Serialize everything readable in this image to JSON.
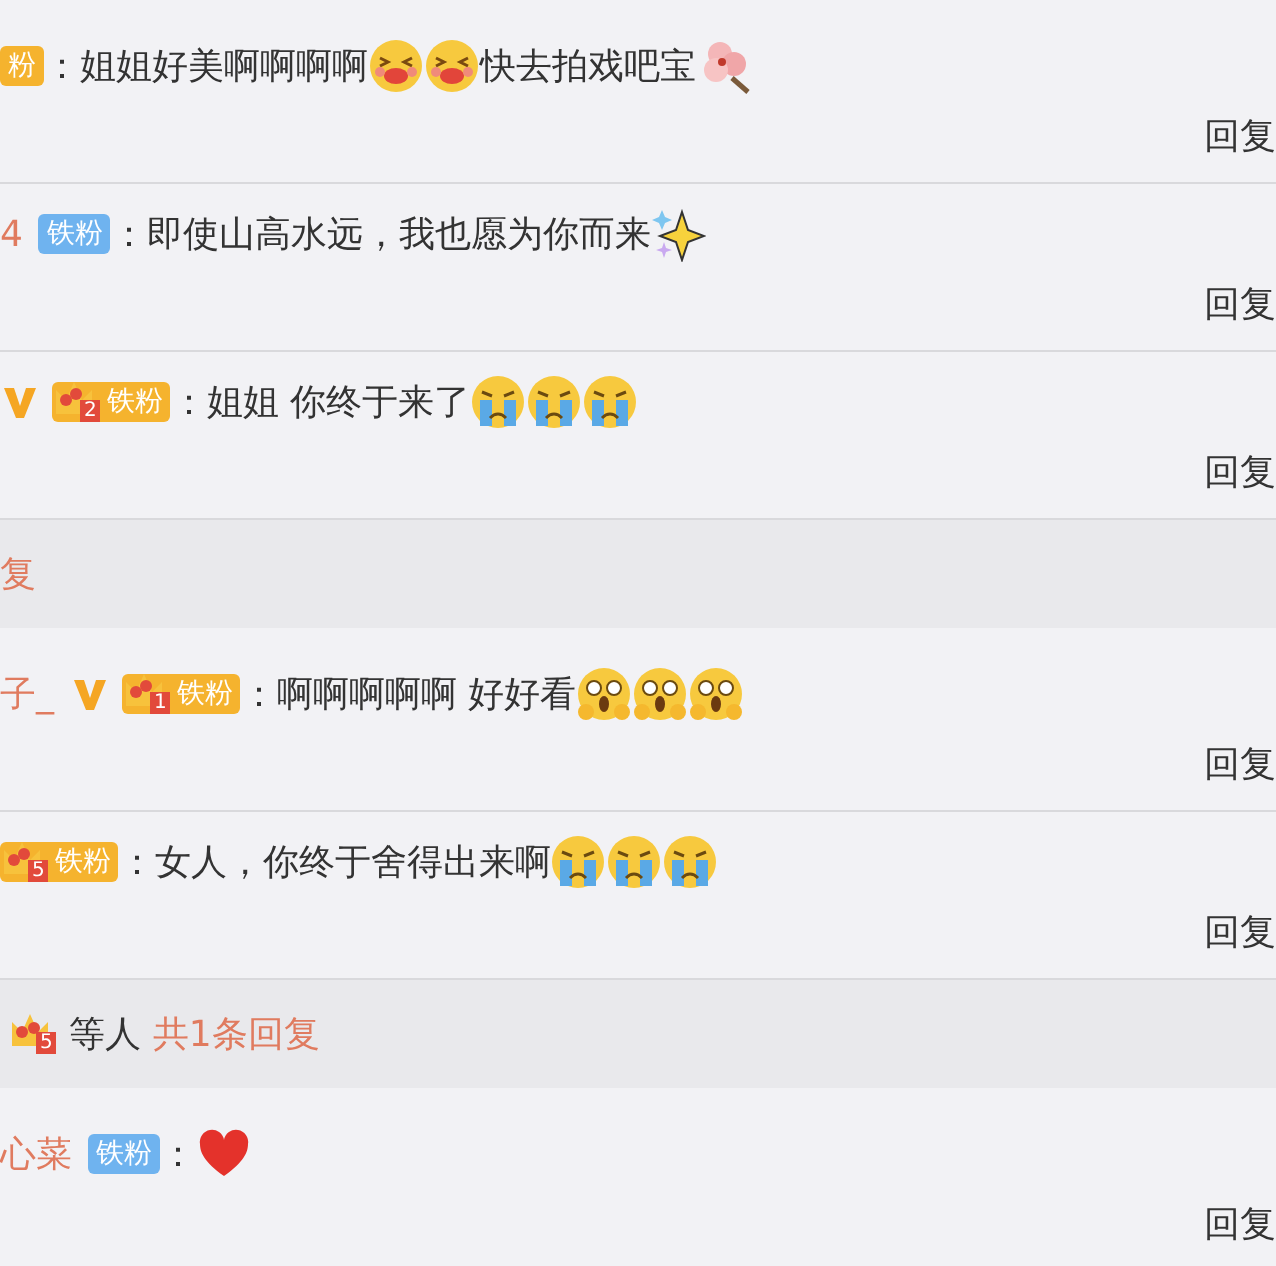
{
  "items": [
    {
      "kind": "comment",
      "vip": false,
      "badge": {
        "kind": "orange",
        "label": "粉"
      },
      "message": [
        {
          "kind": "text",
          "text": "：姐姐好美啊啊啊啊"
        },
        {
          "kind": "kiss"
        },
        {
          "kind": "kiss"
        },
        {
          "kind": "text",
          "text": "快去拍戏吧宝"
        },
        {
          "kind": "flower"
        }
      ],
      "reply": "回复"
    },
    {
      "kind": "comment",
      "user": "4",
      "vip": false,
      "badge": {
        "kind": "blue",
        "label": "铁粉"
      },
      "message": [
        {
          "kind": "text",
          "text": "：即使山高水远，我也愿为你而来"
        },
        {
          "kind": "sparkle"
        }
      ],
      "reply": "回复"
    },
    {
      "kind": "comment",
      "vip": true,
      "badge": {
        "kind": "crown",
        "rank": "2",
        "label": "铁粉"
      },
      "message": [
        {
          "kind": "text",
          "text": "：姐姐 你终于来了"
        },
        {
          "kind": "cry"
        },
        {
          "kind": "cry"
        },
        {
          "kind": "cry"
        }
      ],
      "reply": "回复"
    },
    {
      "kind": "summary",
      "count_text": "复"
    },
    {
      "kind": "comment",
      "user": "子_",
      "vip": true,
      "badge": {
        "kind": "crown",
        "rank": "1",
        "label": "铁粉"
      },
      "message": [
        {
          "kind": "text",
          "text": "：啊啊啊啊啊 好好看"
        },
        {
          "kind": "scared"
        },
        {
          "kind": "scared"
        },
        {
          "kind": "scared"
        }
      ],
      "reply": "回复"
    },
    {
      "kind": "comment",
      "vip": false,
      "badge": {
        "kind": "crown",
        "rank": "5",
        "label": "铁粉"
      },
      "message": [
        {
          "kind": "text",
          "text": "：女人，你终于舍得出来啊"
        },
        {
          "kind": "cry"
        },
        {
          "kind": "cry"
        },
        {
          "kind": "cry"
        }
      ],
      "reply": "回复"
    },
    {
      "kind": "summary",
      "crown_rank": "5",
      "names": "等人",
      "count_text": "共1条回复"
    },
    {
      "kind": "comment",
      "user": "心菜",
      "vip": false,
      "badge": {
        "kind": "blue",
        "label": "铁粉"
      },
      "message": [
        {
          "kind": "text",
          "text": "："
        },
        {
          "kind": "heart"
        }
      ],
      "reply": "回复"
    }
  ]
}
